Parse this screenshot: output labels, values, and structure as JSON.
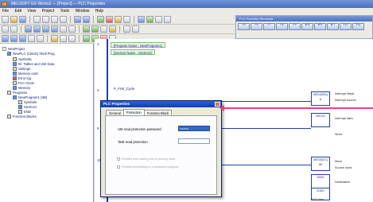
{
  "window": {
    "title": "MELSOFT GX Works2 — [Project] — PLC Properties"
  },
  "menubar": {
    "items": [
      "File",
      "Edit",
      "View",
      "Project",
      "Tools",
      "Window",
      "Help"
    ]
  },
  "function_toolbar": {
    "title": "PLC Function Shortcuts",
    "keys": [
      "F5",
      "F6",
      "F7",
      "F8",
      "F9",
      "sF5",
      "sF6",
      "sF7",
      "F10",
      "F11"
    ]
  },
  "nav": {
    "items": [
      {
        "label": "NewProject"
      },
      {
        "label": "NewPLC (CBUS) Shell Prog"
      },
      {
        "label": "Symbolic"
      },
      {
        "label": "ID: Tables and Unit Data"
      },
      {
        "label": "Settings"
      },
      {
        "label": "Memory card"
      },
      {
        "label": "Error log"
      },
      {
        "label": "PLC Clock"
      },
      {
        "label": "Memory"
      },
      {
        "label": "Programs"
      },
      {
        "label": "NewProgram1 (SB)"
      },
      {
        "label": "Symbols"
      },
      {
        "label": "Section1"
      },
      {
        "label": "END"
      },
      {
        "label": "Function Blocks"
      }
    ]
  },
  "ladder": {
    "row_numbers": [
      "1",
      "2",
      "9",
      "15"
    ],
    "comment_1": "[Program Name : NewProgram1]",
    "comment_2": "[Section Name : Section1]",
    "first_cycle": "P_First_Cycle",
    "instructions": [
      {
        "top": "MOV(000)",
        "bottom": "&"
      },
      {
        "top": "W0.00",
        "bottom": ""
      },
      {
        "top": "MOV(021)",
        "bottom": "#0"
      },
      {
        "top": "#310",
        "bottom": ""
      },
      {
        "top": "D100",
        "bottom": ""
      }
    ],
    "notes": [
      "Interrupt Mask",
      "Interrupt source",
      "Interrupt data",
      "Word",
      "Source word",
      "Destination",
      "Move",
      "0001 Hex"
    ]
  },
  "dialog": {
    "title": "PLC Properties",
    "close_label": "×",
    "tabs": [
      "General",
      "Protection",
      "Function Block"
    ],
    "active_tab": "Protection",
    "uM_label": "UM read protection password",
    "uM_value": "••••••••",
    "task_label": "Task read protection",
    "task_value": "",
    "check_1": "Prohibit from saving into a memory card",
    "check_2": "Prohibit overwriting to a protected program"
  }
}
